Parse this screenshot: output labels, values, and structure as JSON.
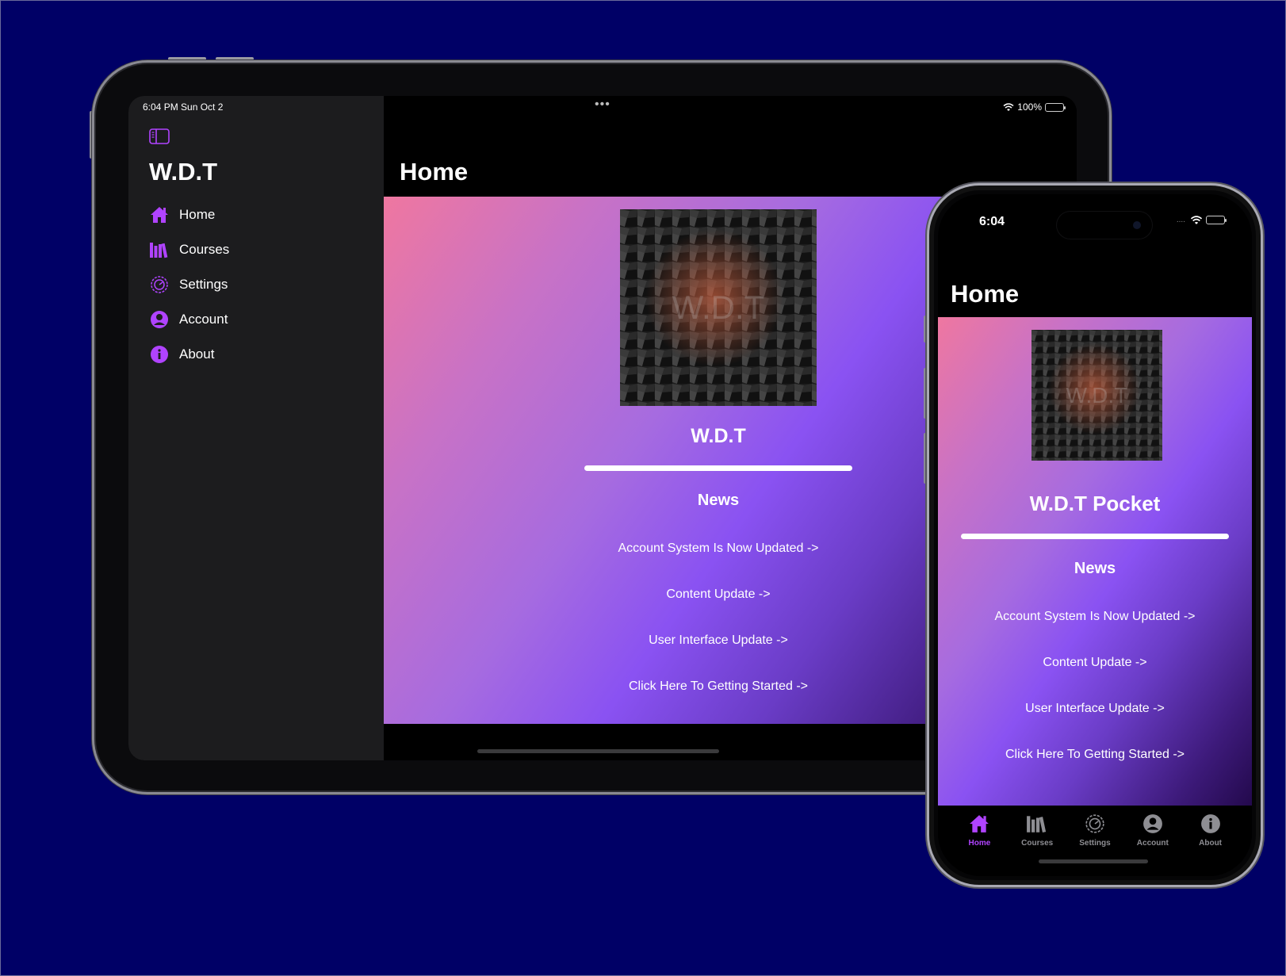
{
  "ipad": {
    "status": {
      "time": "6:04 PM   Sun Oct 2",
      "multitask_dots": "•••",
      "battery": "100%"
    },
    "sidebar": {
      "title": "W.D.T",
      "items": [
        {
          "label": "Home",
          "icon": "house-icon"
        },
        {
          "label": "Courses",
          "icon": "books-icon"
        },
        {
          "label": "Settings",
          "icon": "gear-icon"
        },
        {
          "label": "Account",
          "icon": "person-circle-icon"
        },
        {
          "label": "About",
          "icon": "info-circle-icon"
        }
      ]
    },
    "main": {
      "title": "Home",
      "logo_text": "W.D.T",
      "app_name": "W.D.T",
      "news_heading": "News",
      "news": [
        "Account System Is Now Updated ->",
        "Content Update ->",
        "User Interface Update ->",
        "Click Here To Getting Started ->"
      ]
    }
  },
  "iphone": {
    "status": {
      "time": "6:04",
      "signal": "...."
    },
    "title": "Home",
    "logo_text": "W.D.T",
    "app_name": "W.D.T Pocket",
    "news_heading": "News",
    "news": [
      "Account System Is Now Updated ->",
      "Content Update ->",
      "User Interface Update ->",
      "Click Here To Getting Started ->"
    ],
    "tabs": [
      {
        "label": "Home",
        "icon": "house-icon",
        "active": true
      },
      {
        "label": "Courses",
        "icon": "books-icon",
        "active": false
      },
      {
        "label": "Settings",
        "icon": "gear-icon",
        "active": false
      },
      {
        "label": "Account",
        "icon": "person-circle-icon",
        "active": false
      },
      {
        "label": "About",
        "icon": "info-circle-icon",
        "active": false
      }
    ]
  },
  "colors": {
    "background": "#000066",
    "accent": "#b043ff",
    "gradient_start": "#ef77a0",
    "gradient_mid": "#8a52f2",
    "gradient_end": "#23094c"
  }
}
